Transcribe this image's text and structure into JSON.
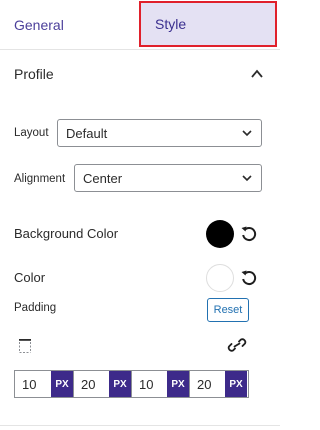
{
  "tabs": [
    {
      "label": "General",
      "active": false
    },
    {
      "label": "Style",
      "active": true
    }
  ],
  "section": {
    "title": "Profile",
    "expanded": true
  },
  "layout": {
    "label": "Layout",
    "value": "Default"
  },
  "alignment": {
    "label": "Alignment",
    "value": "Center"
  },
  "background_color": {
    "label": "Background Color",
    "color": "#000000"
  },
  "text_color": {
    "label": "Color",
    "color": "#ffffff"
  },
  "padding": {
    "label": "Padding",
    "reset_label": "Reset",
    "values": [
      {
        "value": "10",
        "unit": "PX"
      },
      {
        "value": "20",
        "unit": "PX"
      },
      {
        "value": "10",
        "unit": "PX"
      },
      {
        "value": "20",
        "unit": "PX"
      }
    ]
  },
  "colors": {
    "accent": "#3d2a8a",
    "tab_active_bg": "#e4e1f3",
    "highlight_border": "#e0202b",
    "button_blue": "#2271b1"
  }
}
